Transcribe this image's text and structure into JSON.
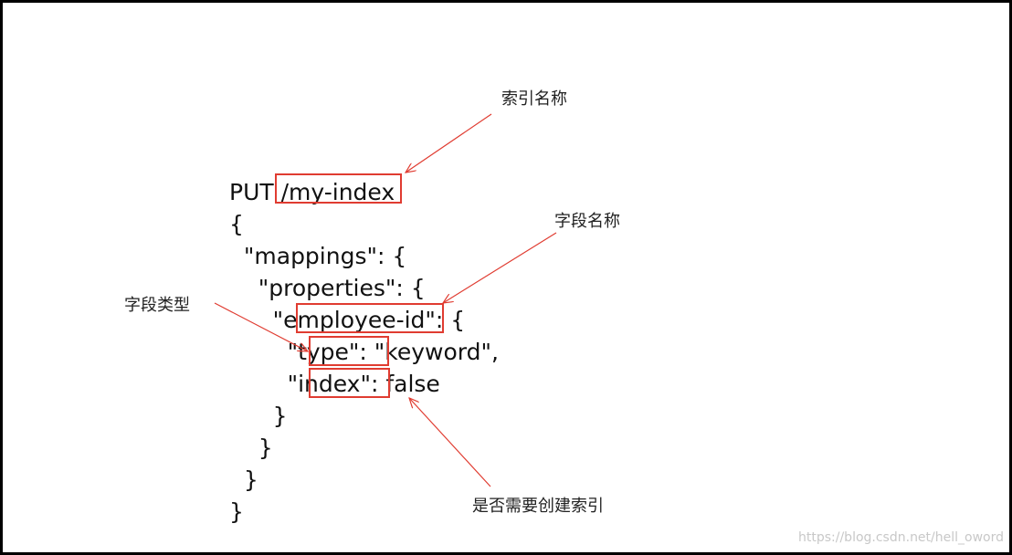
{
  "code": {
    "lines": [
      "PUT /my-index",
      "{",
      "  \"mappings\": {",
      "    \"properties\": {",
      "      \"employee-id\": {",
      "        \"type\": \"keyword\",",
      "        \"index\": false",
      "      }",
      "    }",
      "  }",
      "}"
    ]
  },
  "annotations": {
    "index_name": "索引名称",
    "field_name": "字段名称",
    "field_type": "字段类型",
    "need_index": "是否需要创建索引"
  },
  "watermark": "https://blog.csdn.net/hell_oword",
  "colors": {
    "highlight": "#e03c31",
    "arrow": "#e03c31",
    "border": "#000000"
  }
}
